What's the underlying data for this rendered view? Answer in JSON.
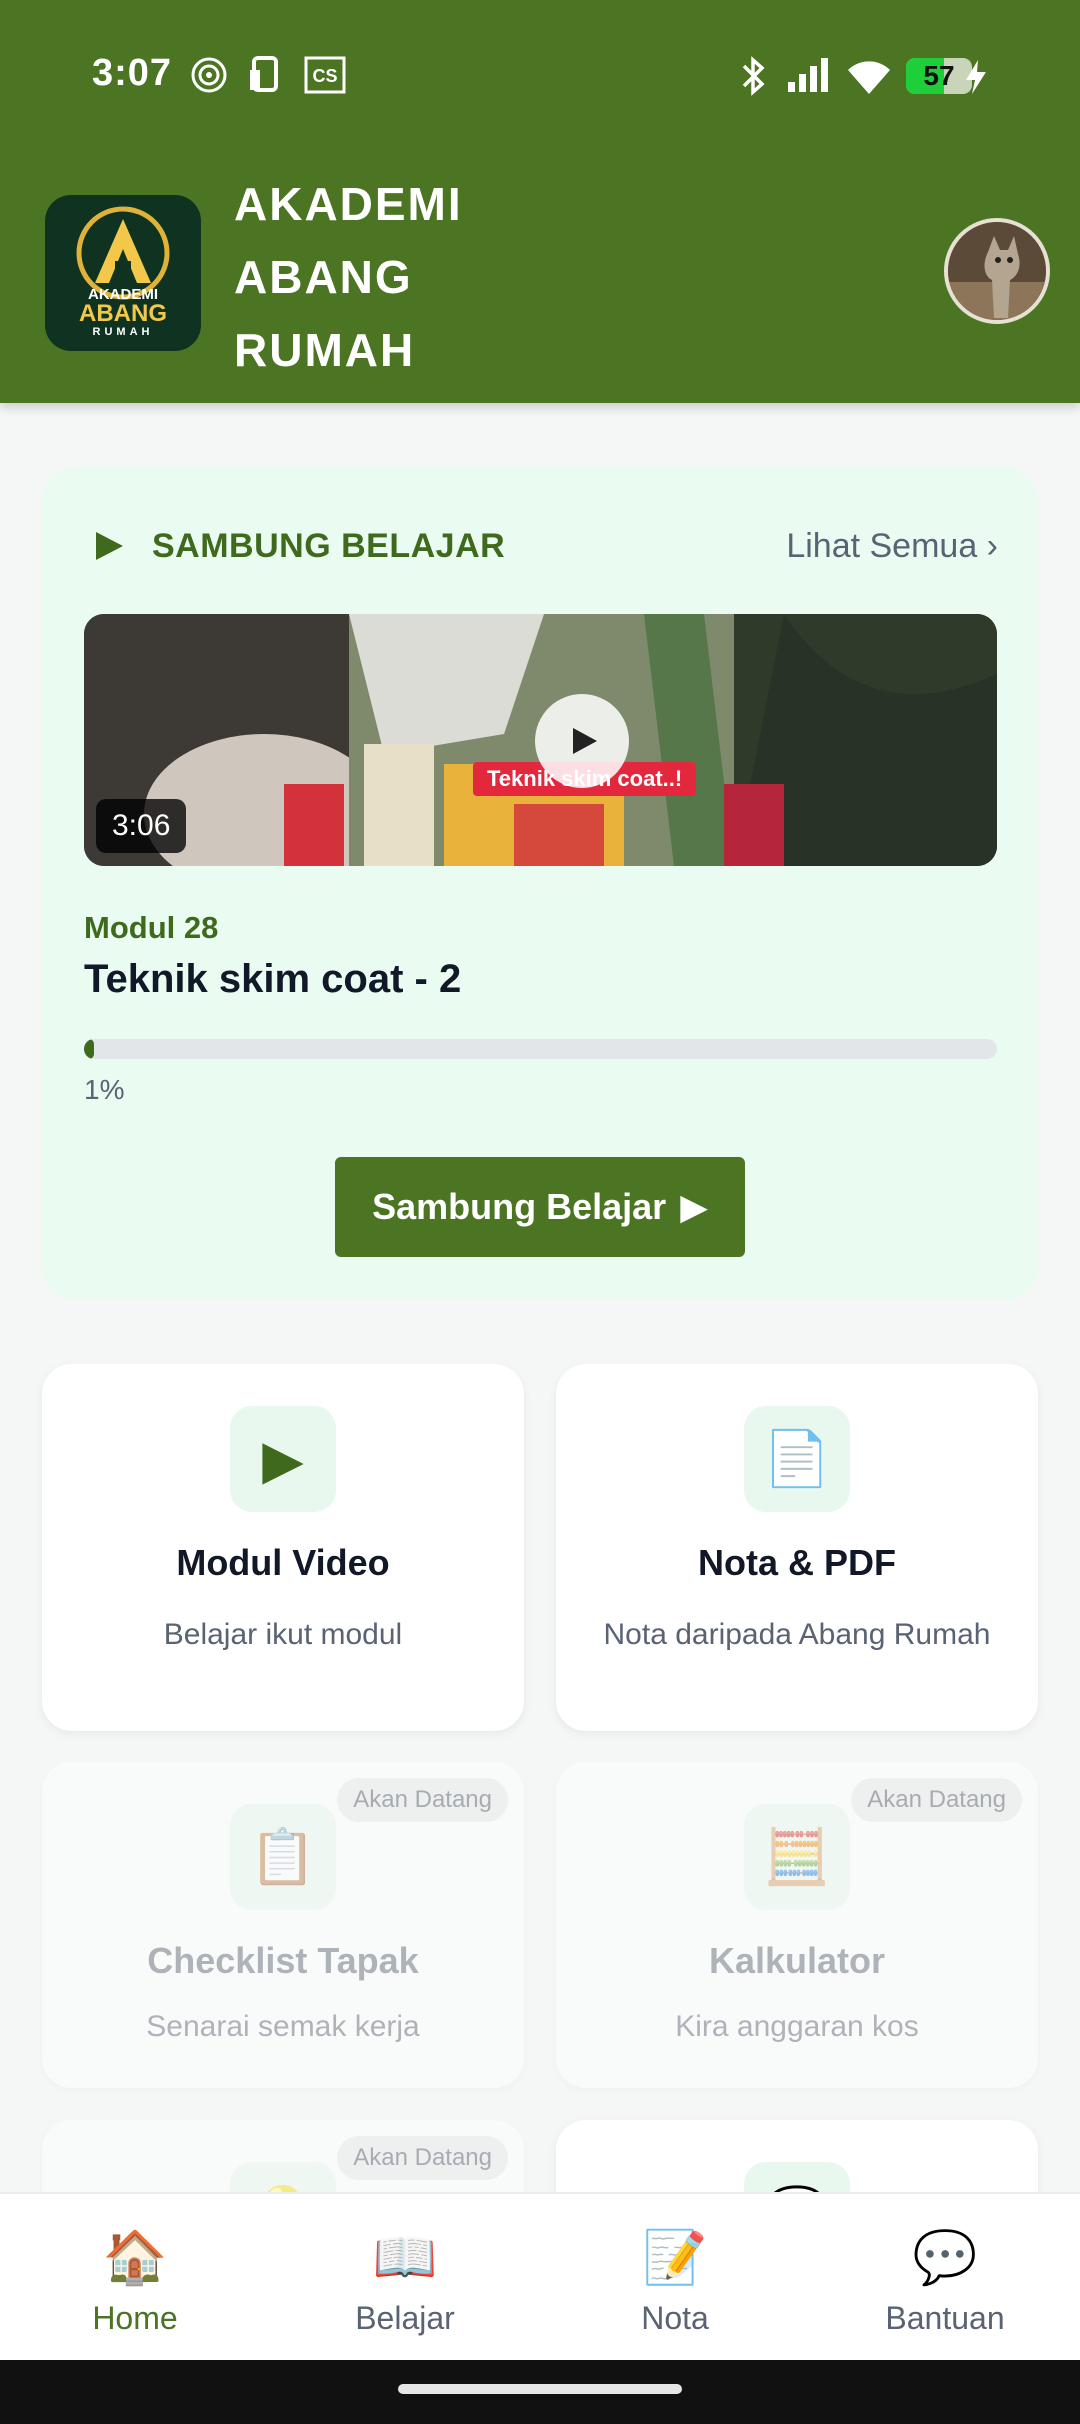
{
  "status_bar": {
    "time": "3:07",
    "battery": "57",
    "battery_level": 0.57
  },
  "header": {
    "logo": {
      "line1": "AKADEMI",
      "line2": "ABANG",
      "line3": "RUMAH"
    },
    "title_lines": [
      "AKADEMI",
      "ABANG",
      "RUMAH"
    ]
  },
  "continue_learning": {
    "title": "SAMBUNG BELAJAR",
    "see_all": "Lihat Semua ›",
    "video": {
      "duration": "3:06",
      "overlay_text": "Teknik skim coat..!"
    },
    "module_number": "Modul 28",
    "module_title": "Teknik skim coat - 2",
    "progress_percent": 1,
    "progress_text": "1%",
    "button_label": "Sambung Belajar",
    "button_arrow": "▶"
  },
  "features": [
    {
      "title": "Modul Video",
      "subtitle": "Belajar ikut modul",
      "icon": "play-icon",
      "glyph": "▶",
      "badge": ""
    },
    {
      "title": "Nota & PDF",
      "subtitle": "Nota daripada Abang Rumah",
      "icon": "document-icon",
      "glyph": "📄",
      "badge": ""
    },
    {
      "title": "Checklist Tapak",
      "subtitle": "Senarai semak kerja",
      "icon": "clipboard-icon",
      "glyph": "📋",
      "badge": "Akan Datang"
    },
    {
      "title": "Kalkulator",
      "subtitle": "Kira anggaran kos",
      "icon": "abacus-icon",
      "glyph": "🧮",
      "badge": "Akan Datang"
    },
    {
      "badge": "Akan Datang",
      "icon": "lightbulb-icon",
      "glyph": "💡"
    },
    {
      "badge": "",
      "icon": "chat-icon",
      "glyph": "💬"
    }
  ],
  "bottom_nav": [
    {
      "label": "Home",
      "icon": "home-icon",
      "glyph": "🏠",
      "active": true
    },
    {
      "label": "Belajar",
      "icon": "book-icon",
      "glyph": "📖",
      "active": false
    },
    {
      "label": "Nota",
      "icon": "memo-icon",
      "glyph": "📝",
      "active": false
    },
    {
      "label": "Bantuan",
      "icon": "speech-bubble-icon",
      "glyph": "💬",
      "active": false
    }
  ],
  "colors": {
    "brand": "#4b7423",
    "card_tint": "#eafbf1",
    "accent_red": "#e3283e"
  }
}
